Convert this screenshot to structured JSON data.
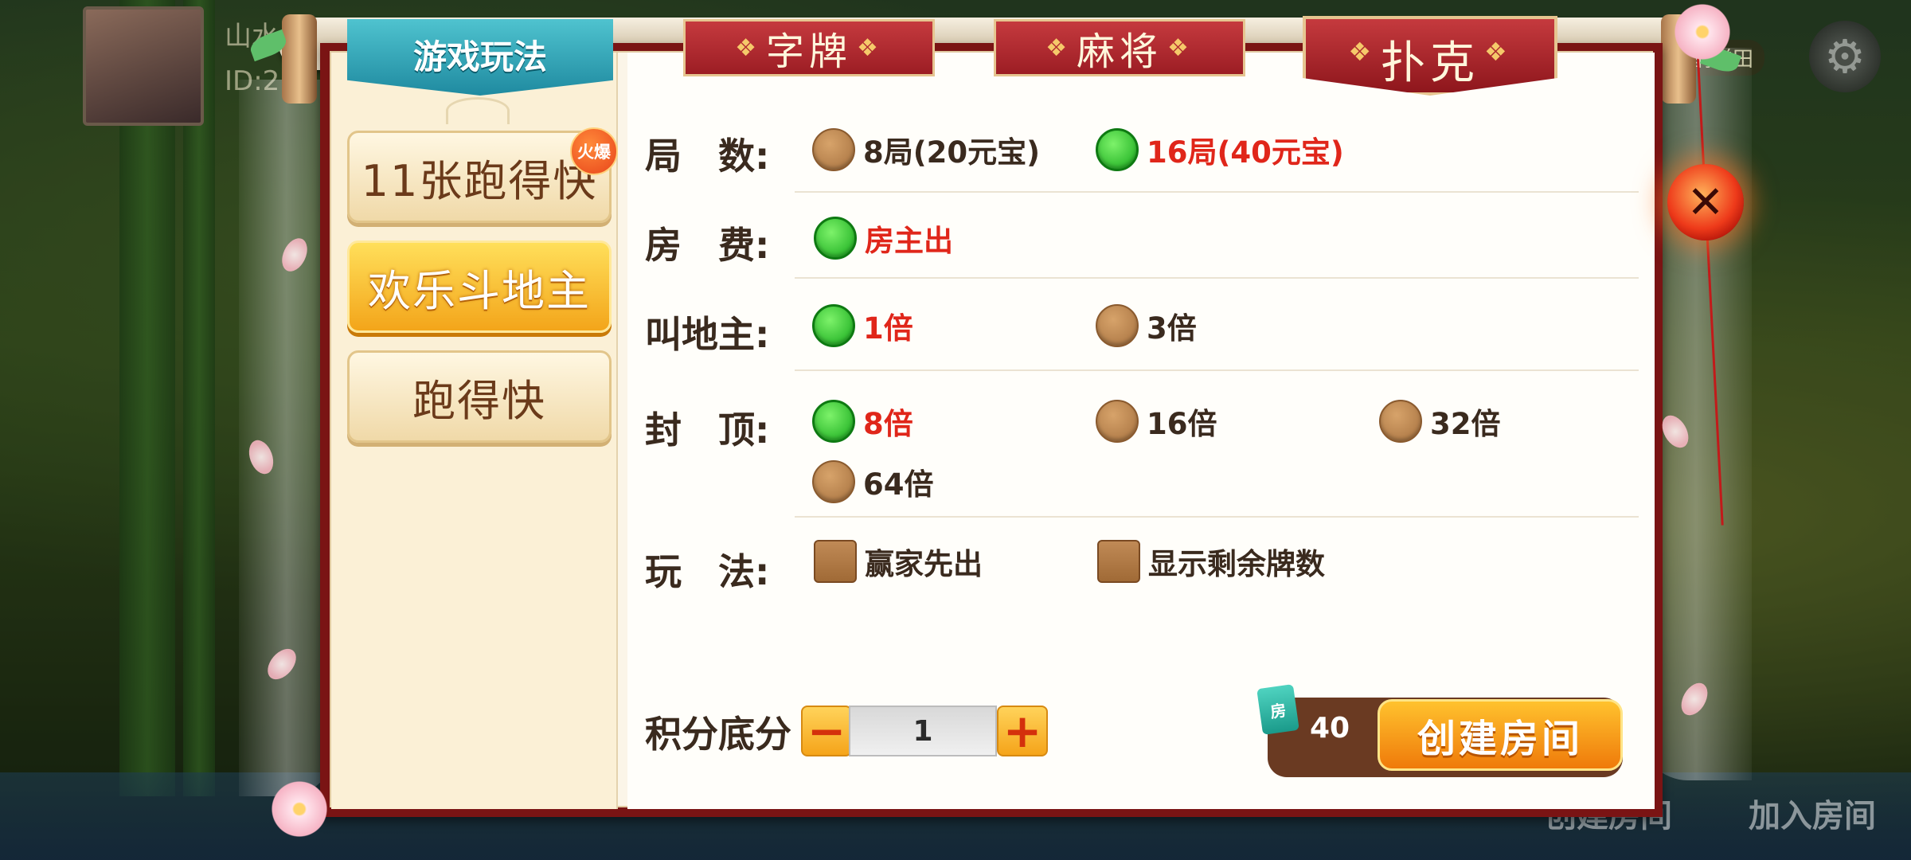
{
  "header": {
    "user_name": "山水",
    "user_id": "ID:2",
    "ladder_label": "鹊梯田"
  },
  "background": {
    "bottom_labels": [
      "创建房间",
      "加入房间"
    ]
  },
  "tabs": {
    "howto": "游戏玩法",
    "items": [
      {
        "label": "字牌",
        "ornament": "❖"
      },
      {
        "label": "麻将",
        "ornament": "❖"
      },
      {
        "label": "扑克",
        "ornament": "❖",
        "active": true
      }
    ]
  },
  "games": [
    {
      "label": "11张跑得快",
      "badge": "火爆",
      "active": false
    },
    {
      "label": "欢乐斗地主",
      "active": true
    },
    {
      "label": "跑得快",
      "active": false
    }
  ],
  "options": {
    "rounds": {
      "label": "局　数:",
      "choices": [
        {
          "text": "8局(20元宝)",
          "selected": false
        },
        {
          "text": "16局(40元宝)",
          "selected": true
        }
      ]
    },
    "room_fee": {
      "label": "房　费:",
      "choices": [
        {
          "text": "房主出",
          "selected": true
        }
      ]
    },
    "call_landlord": {
      "label": "叫地主:",
      "choices": [
        {
          "text": "1倍",
          "selected": true
        },
        {
          "text": "3倍",
          "selected": false
        }
      ]
    },
    "cap": {
      "label": "封　顶:",
      "choices": [
        {
          "text": "8倍",
          "selected": true
        },
        {
          "text": "16倍",
          "selected": false
        },
        {
          "text": "32倍",
          "selected": false
        },
        {
          "text": "64倍",
          "selected": false
        }
      ]
    },
    "play": {
      "label": "玩　法:",
      "choices": [
        {
          "text": "赢家先出",
          "checked": false
        },
        {
          "text": "显示剩余牌数",
          "checked": false
        }
      ]
    }
  },
  "score": {
    "label": "积分底分",
    "minus": "−",
    "plus": "+",
    "value": "1"
  },
  "create": {
    "card_icon": "房",
    "cost": "40",
    "button_label": "创建房间"
  },
  "close_glyph": "✕",
  "icons": {
    "gear": "gear-icon",
    "close": "close-icon",
    "room_card": "room-card-icon"
  },
  "colors": {
    "selected_text": "#e0261a",
    "radio_on": "#14a81a",
    "radio_off": "#a5703e",
    "accent_orange": "#ef7a0a",
    "panel_red": "#7a1414"
  }
}
